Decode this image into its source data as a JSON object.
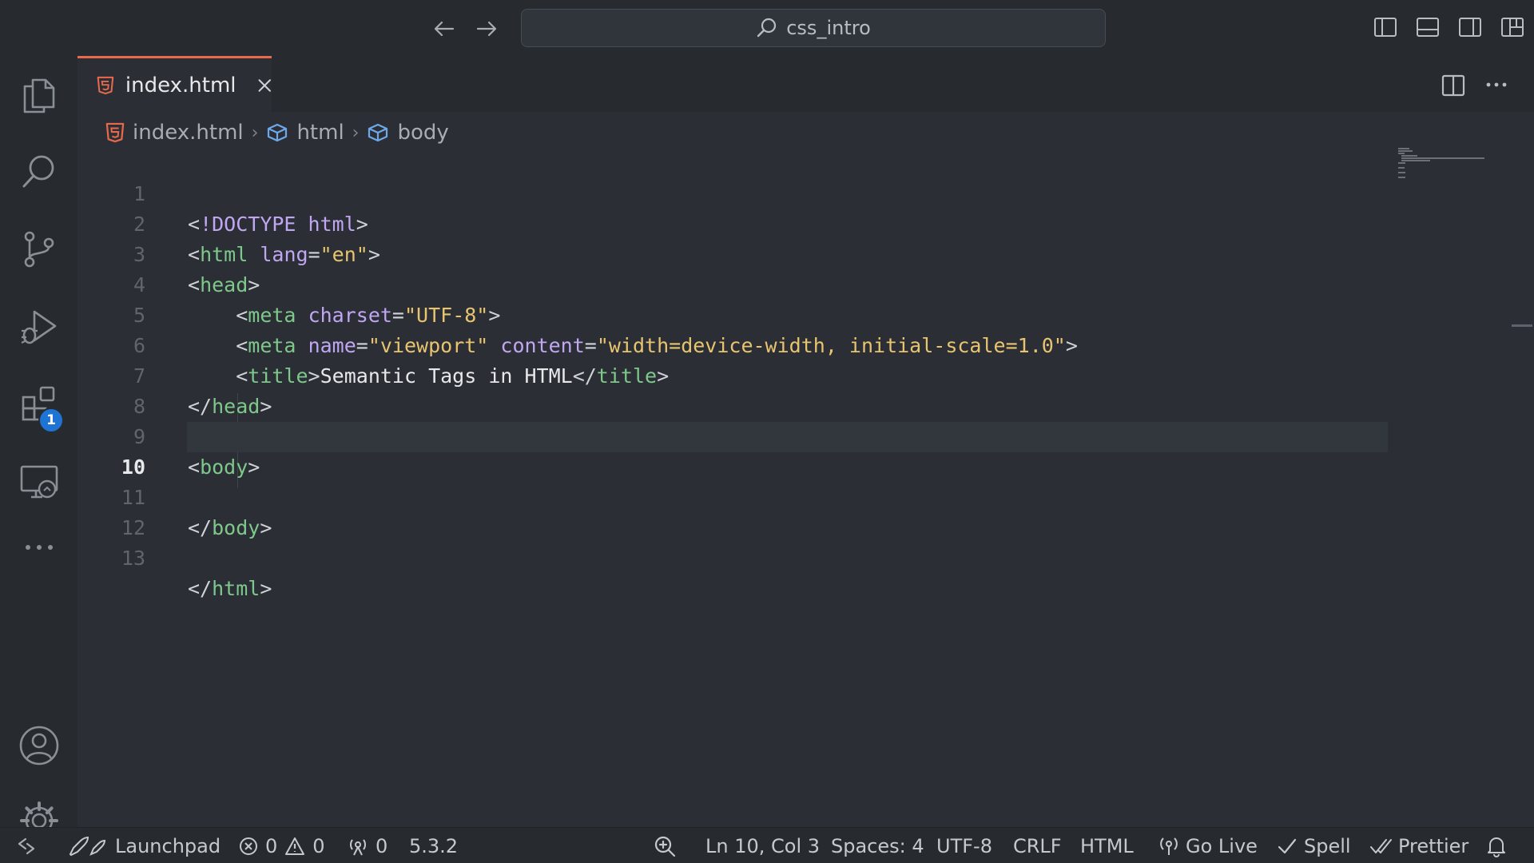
{
  "titlebar": {
    "search_text": "css_intro",
    "icons": [
      "arrow-left-icon",
      "arrow-right-icon",
      "search-icon",
      "toggle-primary-sidebar-icon",
      "toggle-panel-icon",
      "toggle-secondary-sidebar-icon",
      "customize-layout-icon"
    ]
  },
  "activity_bar": {
    "items": [
      "explorer",
      "search",
      "source-control",
      "run-and-debug",
      "extensions",
      "remote-explorer",
      "more"
    ],
    "extensions_badge": "1",
    "bottom": [
      "accounts",
      "manage"
    ]
  },
  "tab": {
    "label": "index.html",
    "icon": "html5-icon"
  },
  "breadcrumb": {
    "file": "index.html",
    "items": [
      "html",
      "body"
    ]
  },
  "editor": {
    "current_line": 10,
    "lines": [
      {
        "n": "1",
        "t": "doctype"
      },
      {
        "n": "2"
      },
      {
        "n": "3"
      },
      {
        "n": "4"
      },
      {
        "n": "5"
      },
      {
        "n": "6"
      },
      {
        "n": "7"
      },
      {
        "n": "8"
      },
      {
        "n": "9"
      },
      {
        "n": "10"
      },
      {
        "n": "11"
      },
      {
        "n": "12"
      },
      {
        "n": "13"
      }
    ],
    "tokens": {
      "doctype_kw": "!DOCTYPE",
      "html": "html",
      "lang_attr": "lang",
      "lang_val": "\"en\"",
      "head": "head",
      "meta": "meta",
      "charset_attr": "charset",
      "charset_val": "\"UTF-8\"",
      "name_attr": "name",
      "name_val": "\"viewport\"",
      "content_attr": "content",
      "content_val": "\"width=device-width, initial-scale=1.0\"",
      "title": "title",
      "title_text": "Semantic Tags in HTML",
      "body": "body"
    }
  },
  "statusbar": {
    "launchpad": "Launchpad",
    "errors": "0",
    "warnings": "0",
    "ports": "0",
    "version": "5.3.2",
    "cursor": "Ln 10, Col 3",
    "spaces": "Spaces: 4",
    "encoding": "UTF-8",
    "eol": "CRLF",
    "language": "HTML",
    "go_live": "Go Live",
    "spell": "Spell",
    "prettier": "Prettier"
  },
  "colors": {
    "accent_tab_border": "#e8694c",
    "badge": "#1e74d4",
    "tag": "#7ec88b",
    "attribute": "#c1a6f2",
    "string": "#e9c46f",
    "html_file_icon": "#e8694c"
  }
}
